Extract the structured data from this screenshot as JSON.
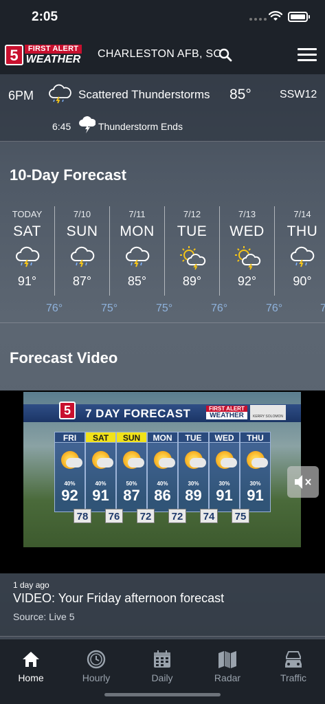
{
  "status_bar": {
    "time": "2:05"
  },
  "header": {
    "logo": {
      "number": "5",
      "line1": "FIRST ALERT",
      "line2": "WEATHER"
    },
    "location": "CHARLESTON AFB, SC",
    "search_icon": "search-icon",
    "menu_icon": "hamburger-menu-icon"
  },
  "current": {
    "time": "6PM",
    "condition": "Scattered Thunderstorms",
    "temp": "85°",
    "wind": "SSW12",
    "icon": "thunderstorm-cloud-icon",
    "alert": {
      "time": "6:45",
      "text": "Thunderstorm Ends",
      "icon": "lightning-cloud-icon"
    }
  },
  "ten_day": {
    "title": "10-Day Forecast",
    "days": [
      {
        "date": "TODAY",
        "name": "SAT",
        "icon": "thunderstorm-icon",
        "hi": "91°",
        "lo": "76°"
      },
      {
        "date": "7/10",
        "name": "SUN",
        "icon": "thunderstorm-icon",
        "hi": "87°",
        "lo": "75°"
      },
      {
        "date": "7/11",
        "name": "MON",
        "icon": "thunderstorm-icon",
        "hi": "85°",
        "lo": "75°"
      },
      {
        "date": "7/12",
        "name": "TUE",
        "icon": "sun-thunderstorm-icon",
        "hi": "89°",
        "lo": "76°"
      },
      {
        "date": "7/13",
        "name": "WED",
        "icon": "sun-thunderstorm-icon",
        "hi": "92°",
        "lo": "76°"
      },
      {
        "date": "7/14",
        "name": "THU",
        "icon": "thunderstorm-icon",
        "hi": "90°",
        "lo": "7"
      }
    ]
  },
  "forecast_video": {
    "title": "Forecast Video",
    "graphic": {
      "number": "5",
      "title": "7 DAY FORECAST",
      "brand_top": "FIRST ALERT",
      "brand_bottom": "WEATHER",
      "meteorologist": "KERRY SOLOMON",
      "days": [
        {
          "name": "FRI",
          "pct": "40%",
          "hi": "92",
          "lo": "78",
          "highlight": false
        },
        {
          "name": "SAT",
          "pct": "40%",
          "hi": "91",
          "lo": "76",
          "highlight": true
        },
        {
          "name": "SUN",
          "pct": "50%",
          "hi": "87",
          "lo": "72",
          "highlight": true
        },
        {
          "name": "MON",
          "pct": "40%",
          "hi": "86",
          "lo": "72",
          "highlight": false
        },
        {
          "name": "TUE",
          "pct": "30%",
          "hi": "89",
          "lo": "74",
          "highlight": false
        },
        {
          "name": "WED",
          "pct": "30%",
          "hi": "91",
          "lo": "75",
          "highlight": false
        },
        {
          "name": "THU",
          "pct": "30%",
          "hi": "91",
          "lo": "",
          "highlight": false
        }
      ]
    },
    "mute_icon": "speaker-muted-icon",
    "caption": {
      "age": "1 day ago",
      "title": "VIDEO: Your Friday afternoon forecast",
      "source": "Source: Live 5"
    }
  },
  "tab_bar": {
    "tabs": [
      {
        "label": "Home",
        "icon": "home-icon",
        "active": true
      },
      {
        "label": "Hourly",
        "icon": "clock-icon",
        "active": false
      },
      {
        "label": "Daily",
        "icon": "calendar-icon",
        "active": false
      },
      {
        "label": "Radar",
        "icon": "map-icon",
        "active": false
      },
      {
        "label": "Traffic",
        "icon": "car-icon",
        "active": false
      }
    ]
  }
}
